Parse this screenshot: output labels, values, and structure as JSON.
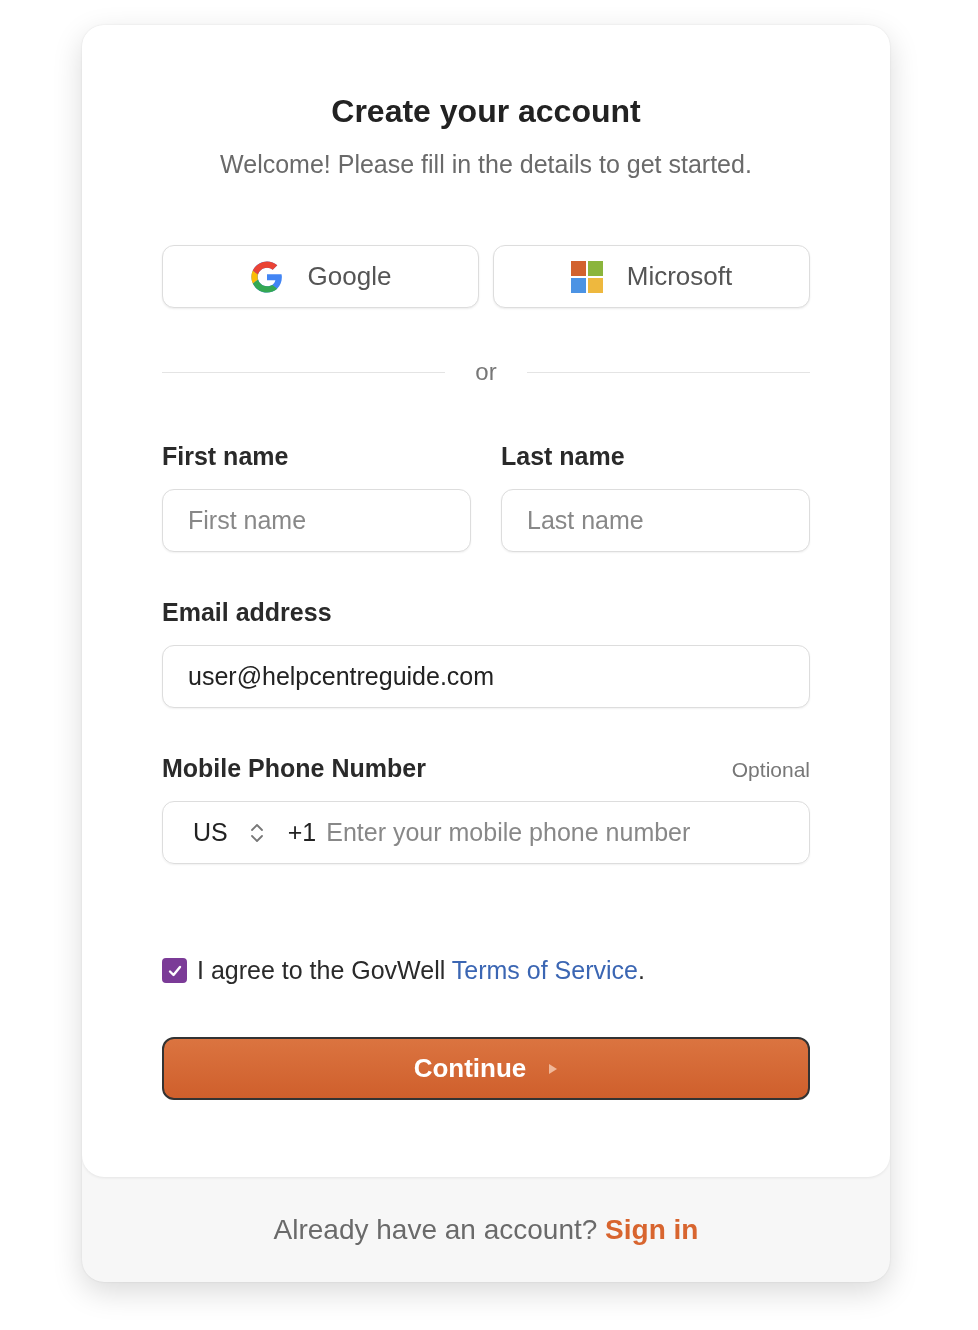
{
  "header": {
    "title": "Create your account",
    "subtitle": "Welcome! Please fill in the details to get started."
  },
  "social_buttons": [
    {
      "kind": "google",
      "label": "Google"
    },
    {
      "kind": "microsoft",
      "label": "Microsoft"
    }
  ],
  "divider": {
    "label": "or"
  },
  "name_fields": [
    {
      "label": "First name",
      "placeholder": "First name"
    },
    {
      "label": "Last name",
      "placeholder": "Last name"
    }
  ],
  "email": {
    "label": "Email address",
    "value": "user@helpcentreguide.com"
  },
  "phone": {
    "label": "Mobile Phone Number",
    "optional": "Optional",
    "country": "US",
    "code": "+1",
    "placeholder": "Enter your mobile phone number"
  },
  "terms": {
    "checked": true,
    "text": "I agree to the GovWell ",
    "link": "Terms of Service",
    "end": "."
  },
  "continue": {
    "label": "Continue"
  },
  "footer": {
    "text": "Already have an account?",
    "link": "Sign in"
  }
}
